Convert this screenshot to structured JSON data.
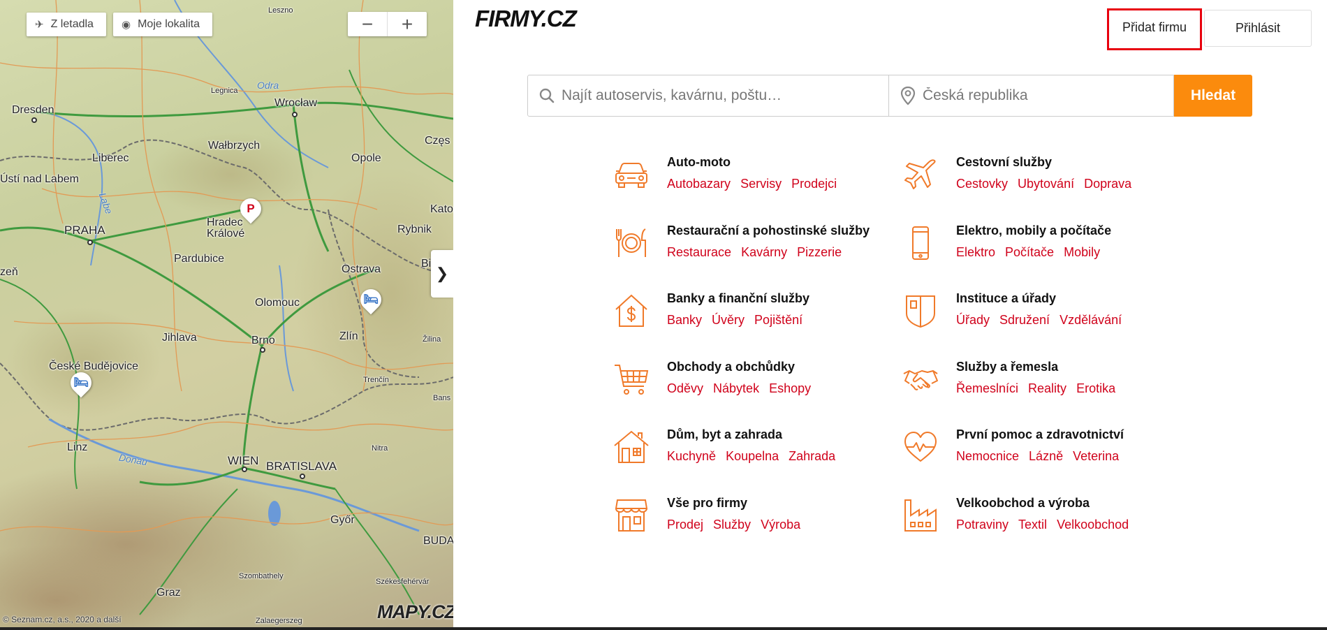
{
  "map": {
    "btn_plane": "Z letadla",
    "btn_location": "Moje lokalita",
    "zoom_out": "−",
    "zoom_in": "+",
    "collapse": "❯",
    "copyright": "© Seznam.cz, a.s., 2020 a další",
    "logo": "MAPY.CZ",
    "cities": [
      "Leszno",
      "Legnica",
      "Wrocław",
      "Dresden",
      "Wałbrzych",
      "Częs",
      "Liberec",
      "Opole",
      "Ústí nad Labem",
      "Kato",
      "Hradec",
      "Králové",
      "Rybnik",
      "PRAHA",
      "Pardubice",
      "zeň",
      "Ostrava",
      "Bi",
      "Olomouc",
      "Jihlava",
      "Brno",
      "Zlín",
      "Žilina",
      "České Budějovice",
      "Trenčín",
      "Bans",
      "Linz",
      "Nitra",
      "WIEN",
      "BRATISLAVA",
      "Győr",
      "BUDA",
      "Szombathely",
      "Székesfehérvár",
      "Graz",
      "Zalaegerszeg"
    ],
    "rivers": [
      "Odra",
      "Labe",
      "Donau"
    ]
  },
  "header": {
    "logo": "FIRMY.CZ",
    "add_company": "Přidat firmu",
    "login": "Přihlásit"
  },
  "search": {
    "what_placeholder": "Najít autoservis, kavárnu, poštu…",
    "where_placeholder": "Česká republika",
    "button": "Hledat"
  },
  "colors": {
    "accent": "#fb8b0d",
    "link": "#d0021b",
    "icon": "#f07a2a",
    "highlight": "#e8000e"
  },
  "categories": [
    {
      "title": "Auto-moto",
      "icon": "car-icon",
      "links": [
        "Autobazary",
        "Servisy",
        "Prodejci"
      ]
    },
    {
      "title": "Cestovní služby",
      "icon": "airplane-icon",
      "links": [
        "Cestovky",
        "Ubytování",
        "Doprava"
      ]
    },
    {
      "title": "Restaurační a pohostinské služby",
      "icon": "plate-cutlery-icon",
      "links": [
        "Restaurace",
        "Kavárny",
        "Pizzerie"
      ]
    },
    {
      "title": "Elektro, mobily a počítače",
      "icon": "phone-icon",
      "links": [
        "Elektro",
        "Počítače",
        "Mobily"
      ]
    },
    {
      "title": "Banky a finanční služby",
      "icon": "bank-dollar-icon",
      "links": [
        "Banky",
        "Úvěry",
        "Pojištění"
      ]
    },
    {
      "title": "Instituce a úřady",
      "icon": "shield-icon",
      "links": [
        "Úřady",
        "Sdružení",
        "Vzdělávání"
      ]
    },
    {
      "title": "Obchody a obchůdky",
      "icon": "cart-icon",
      "links": [
        "Oděvy",
        "Nábytek",
        "Eshopy"
      ]
    },
    {
      "title": "Služby a řemesla",
      "icon": "handshake-icon",
      "links": [
        "Řemeslníci",
        "Reality",
        "Erotika"
      ]
    },
    {
      "title": "Dům, byt a zahrada",
      "icon": "house-icon",
      "links": [
        "Kuchyně",
        "Koupelna",
        "Zahrada"
      ]
    },
    {
      "title": "První pomoc a zdravotnictví",
      "icon": "heart-pulse-icon",
      "links": [
        "Nemocnice",
        "Lázně",
        "Veterina"
      ]
    },
    {
      "title": "Vše pro firmy",
      "icon": "storefront-icon",
      "links": [
        "Prodej",
        "Služby",
        "Výroba"
      ]
    },
    {
      "title": "Velkoobchod a výroba",
      "icon": "factory-icon",
      "links": [
        "Potraviny",
        "Textil",
        "Velkoobchod"
      ]
    }
  ]
}
